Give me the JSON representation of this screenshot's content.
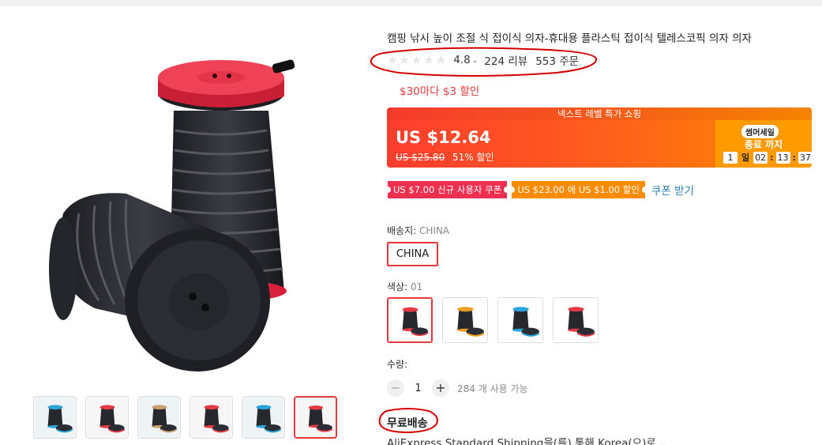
{
  "product": {
    "title": "캠핑 낚시 높이 조절 식 접이식 의자-휴대용 플라스틱 접이식 텔레스코픽 의자 의자",
    "rating": "4.8",
    "reviews": "224 리뷰",
    "orders": "553 주문",
    "promo": "$30마다 $3 할인"
  },
  "sale": {
    "header": "넥스트 레벨 특가 쇼핑",
    "price": "US $12.64",
    "original_price": "US $25.80",
    "discount": "51% 할인",
    "badge": "썸머세일",
    "ends_label": "종료 까지",
    "countdown": {
      "days": "1",
      "days_unit": "일",
      "hours": "02",
      "minutes": "13",
      "seconds": "37"
    }
  },
  "coupons": [
    {
      "label": "US $7.00 신규 사용자 쿠폰"
    },
    {
      "label": "US $23.00 에 US $1.00 할인"
    }
  ],
  "get_coupon": "쿠폰 받기",
  "ship_from": {
    "label": "배송지: ",
    "value": "CHINA",
    "option": "CHINA"
  },
  "color": {
    "label": "색상: ",
    "value": "01",
    "swatch_colors": [
      "#e63946",
      "#f0a020",
      "#2aa4d8",
      "#e63946"
    ]
  },
  "quantity": {
    "label": "수량:",
    "minus": "−",
    "plus": "+",
    "value": "1",
    "available": "284 개 사용 가능"
  },
  "shipping": {
    "free": "무료배송",
    "method": "AliExpress Standard Shipping을(를) 통해 Korea(으)로"
  },
  "thumb_colors": [
    "#2aa4d8",
    "#e63946",
    "#c8a070",
    "#e63946",
    "#2aa4d8",
    "#e63946"
  ],
  "icons": {
    "star": "★",
    "chevron": "⌄"
  },
  "colors": {
    "accent": "#e4393c",
    "link": "#2c7fb8",
    "annotation": "#d40000"
  }
}
